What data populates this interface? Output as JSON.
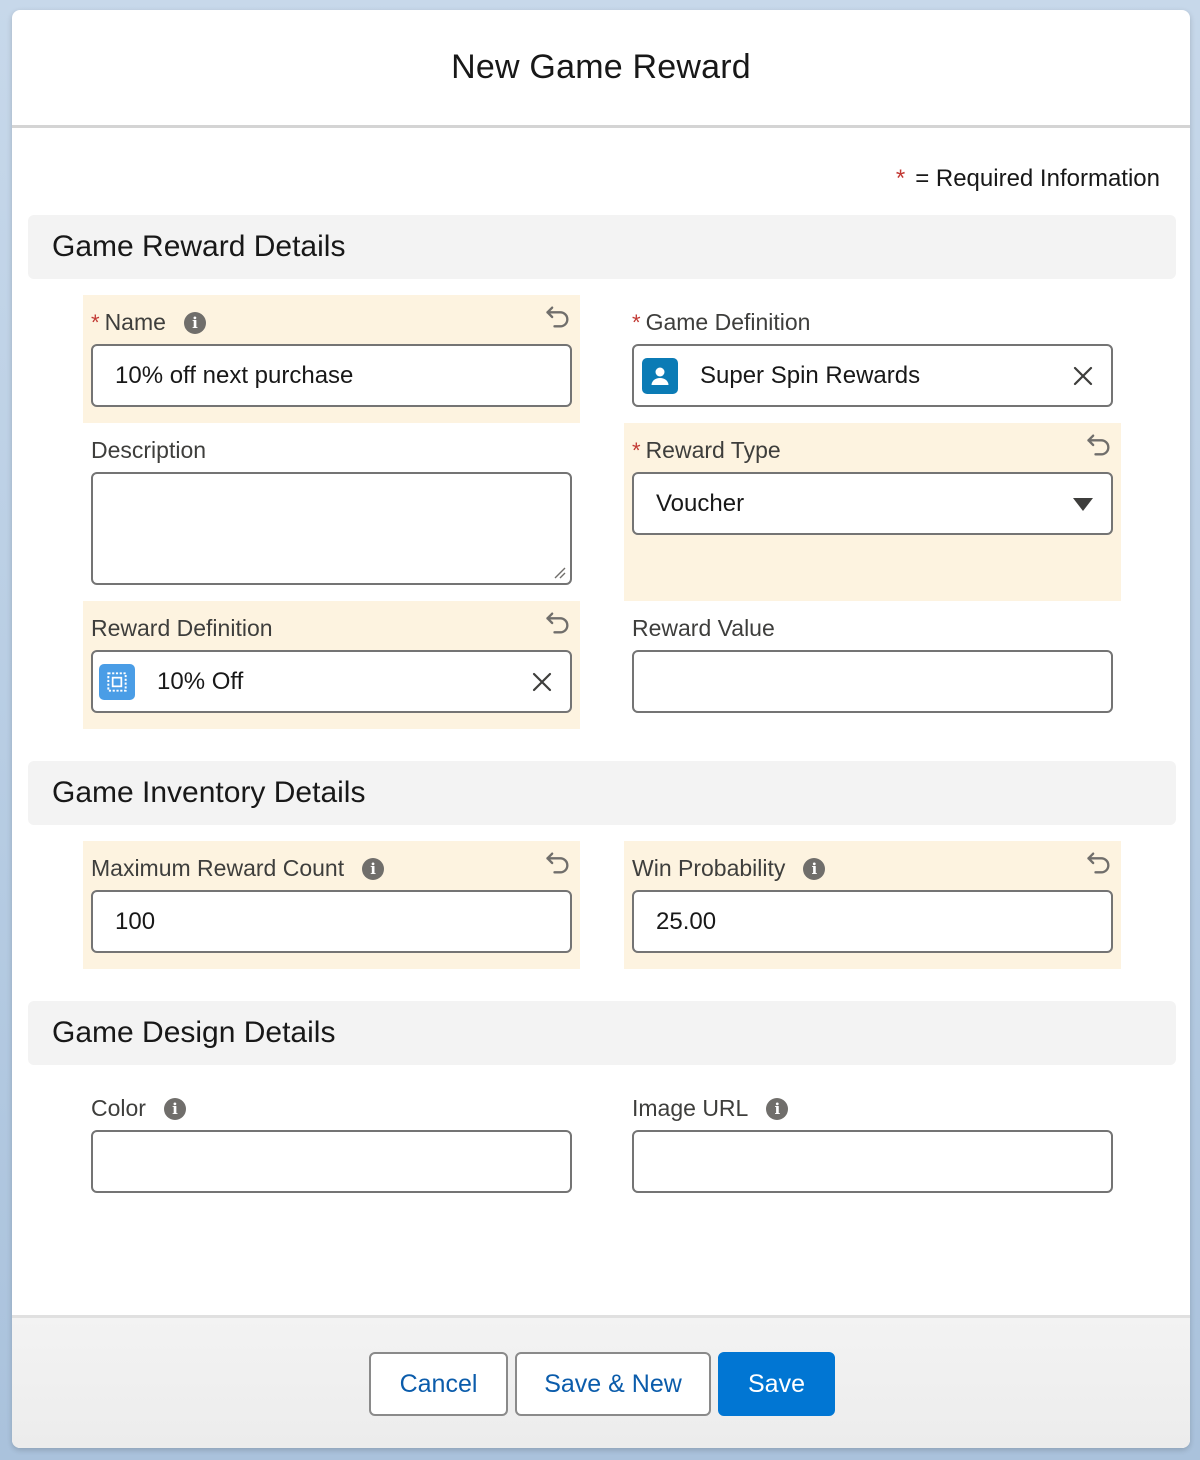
{
  "modal": {
    "title": "New Game Reward",
    "required_star": "*",
    "required_legend": "= Required Information"
  },
  "sections": {
    "reward": {
      "title": "Game Reward Details"
    },
    "inventory": {
      "title": "Game Inventory Details"
    },
    "design": {
      "title": "Game Design Details"
    }
  },
  "fields": {
    "name": {
      "label": "Name",
      "value": "10% off next purchase",
      "required": true
    },
    "game_definition": {
      "label": "Game Definition",
      "value": "Super Spin Rewards",
      "required": true,
      "icon": "user-icon"
    },
    "description": {
      "label": "Description",
      "value": ""
    },
    "reward_type": {
      "label": "Reward Type",
      "value": "Voucher",
      "required": true
    },
    "reward_definition": {
      "label": "Reward Definition",
      "value": "10% Off",
      "icon": "reward-stamp-icon"
    },
    "reward_value": {
      "label": "Reward Value",
      "value": ""
    },
    "maximum_reward_count": {
      "label": "Maximum Reward Count",
      "value": "100"
    },
    "win_probability": {
      "label": "Win Probability",
      "value": "25.00"
    },
    "color": {
      "label": "Color",
      "value": ""
    },
    "image_url": {
      "label": "Image URL",
      "value": ""
    }
  },
  "footer": {
    "cancel_label": "Cancel",
    "save_new_label": "Save & New",
    "save_label": "Save"
  },
  "colors": {
    "brand": "#0176d3",
    "edited_field_bg": "#fdf3e0",
    "required_star": "#c23934",
    "lookup_user_icon_bg": "#0b7bb5",
    "lookup_reward_icon_bg": "#4a9de6"
  }
}
